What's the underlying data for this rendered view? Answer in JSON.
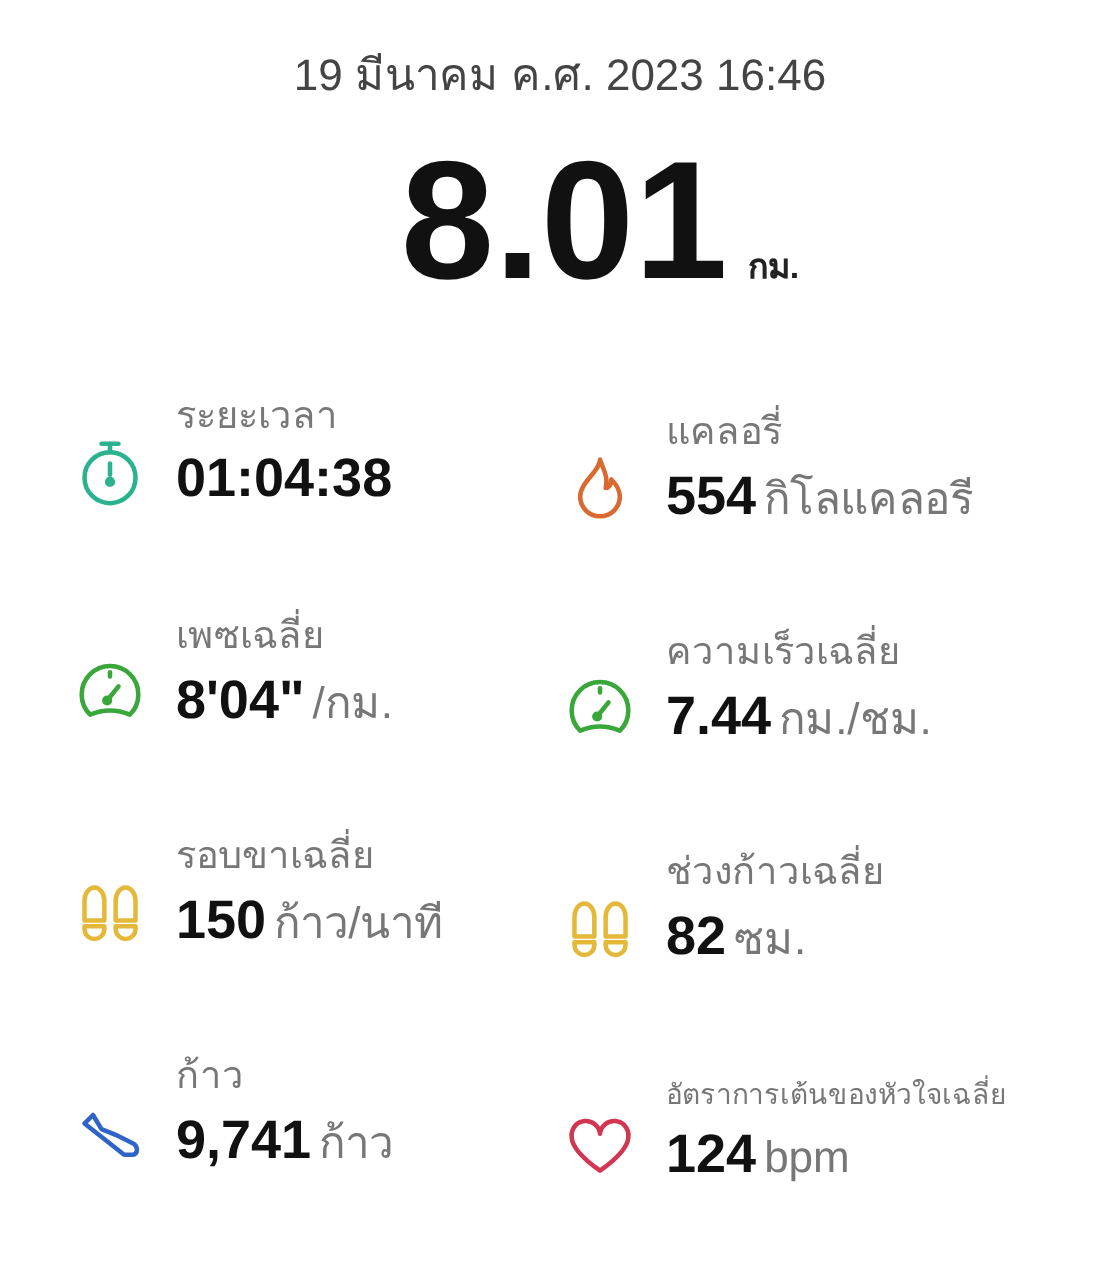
{
  "date": "19 มีนาคม ค.ศ. 2023 16:46",
  "distance": {
    "value": "8.01",
    "unit": "กม."
  },
  "metrics": [
    {
      "kind": "stopwatch",
      "label": "ระยะเวลา",
      "value": "01:04:38"
    },
    {
      "kind": "flame",
      "label": "แคลอรี่",
      "value": "554",
      "unit": "กิโลแคลอรี"
    },
    {
      "kind": "gauge",
      "label": "เพซเฉลี่ย",
      "value": "8'04\"",
      "unit": "/กม."
    },
    {
      "kind": "gauge",
      "label": "ความเร็วเฉลี่ย",
      "value": "7.44",
      "unit": "กม./ชม."
    },
    {
      "kind": "footprints",
      "label": "รอบขาเฉลี่ย",
      "value": "150",
      "unit": "ก้าว/นาที"
    },
    {
      "kind": "footprints",
      "label": "ช่วงก้าวเฉลี่ย",
      "value": "82",
      "unit": "ซม."
    },
    {
      "kind": "shoe",
      "label": "ก้าว",
      "value": "9,741",
      "unit": "ก้าว"
    },
    {
      "kind": "heart",
      "label": "อัตราการเต้นของหัวใจเฉลี่ย",
      "value": "124",
      "unit": "bpm"
    }
  ]
}
